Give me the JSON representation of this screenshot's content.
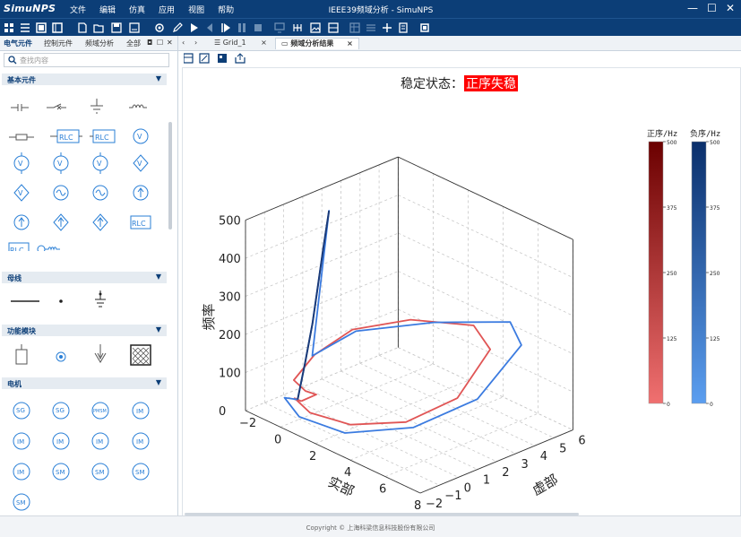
{
  "app": {
    "logo": "SimuNPS",
    "window_title": "IEEE39频域分析 - SimuNPS",
    "menu": [
      "文件",
      "编辑",
      "仿真",
      "应用",
      "视图",
      "帮助"
    ],
    "window_controls": [
      "—",
      "☐",
      "✕"
    ]
  },
  "sidebar": {
    "tabs": [
      "电气元件",
      "控制元件",
      "频域分析",
      "全部"
    ],
    "search_placeholder": "查找内容",
    "sections": [
      {
        "title": "基本元件",
        "items": [
          "ground-symbol",
          "switch-symbol",
          "ground-symbol",
          "inductor-symbol",
          "resistor-symbol",
          "rlc-series",
          "rlc-shunt",
          "voltage-source",
          "voltage-source",
          "voltage-source",
          "voltage-source",
          "controlled-voltage-source",
          "ac-source",
          "ac-source",
          "ac-source",
          "current-source",
          "current-source",
          "controlled-current-source",
          "controlled-current-source",
          "rlc-branch",
          "rlc-branch",
          "mutual-inductor"
        ]
      },
      {
        "title": "母线",
        "items": [
          "bus-line",
          "bus-node",
          "bus-ground"
        ]
      },
      {
        "title": "功能模块",
        "items": [
          "block-symbol",
          "measure-symbol",
          "fault-symbol",
          "hatched-block"
        ]
      },
      {
        "title": "电机",
        "items": [
          "SG",
          "SG",
          "PMSM",
          "IM",
          "IM",
          "IM",
          "IM",
          "IM",
          "IM",
          "SM",
          "SM",
          "SM",
          "SM"
        ]
      }
    ]
  },
  "doc_tabs": {
    "nav": [
      "‹",
      "›"
    ],
    "tabs": [
      {
        "label": "Grid_1",
        "close": "×"
      },
      {
        "label": "频域分析结果",
        "close": "×"
      }
    ]
  },
  "plot": {
    "status_label": "稳定状态：",
    "status_value": "正序失稳",
    "status_color": "#ff0000",
    "z_label": "频率",
    "x_label": "实部",
    "y_label": "虚部",
    "z_ticks": [
      "0",
      "100",
      "200",
      "300",
      "400",
      "500"
    ],
    "x_ticks": [
      "−2",
      "0",
      "2",
      "4",
      "6",
      "8"
    ],
    "y_ticks": [
      "−2",
      "−1",
      "0",
      "1",
      "2",
      "3",
      "4",
      "5",
      "6"
    ],
    "colorbars": [
      {
        "title": "正序/Hz",
        "ticks": [
          "500",
          "375",
          "250",
          "125",
          "0"
        ],
        "color_top": "#6b0000",
        "color_bottom": "#f07070"
      },
      {
        "title": "负序/Hz",
        "ticks": [
          "500",
          "375",
          "250",
          "125",
          "0"
        ],
        "color_top": "#0a2f6b",
        "color_bottom": "#5b9ef0"
      }
    ]
  },
  "chart_data": {
    "type": "line",
    "title": "",
    "xlabel": "实部",
    "ylabel": "虚部",
    "zlabel": "频率",
    "xlim": [
      -2,
      8
    ],
    "ylim": [
      -2,
      6
    ],
    "zlim": [
      0,
      500
    ],
    "series": [
      {
        "name": "正序/Hz",
        "color": "#e05555",
        "points": [
          [
            -1.0,
            0.0,
            5
          ],
          [
            -0.9,
            0.7,
            10
          ],
          [
            -1.3,
            0.5,
            15
          ],
          [
            -1.2,
            -0.2,
            60
          ],
          [
            -0.8,
            0.5,
            120
          ],
          [
            0.3,
            1.5,
            190
          ],
          [
            2.2,
            2.8,
            230
          ],
          [
            4.5,
            4.0,
            240
          ],
          [
            6.0,
            3.5,
            220
          ],
          [
            6.3,
            1.5,
            140
          ],
          [
            5.0,
            0.0,
            80
          ],
          [
            2.7,
            -0.8,
            40
          ],
          [
            0.6,
            -1.0,
            30
          ],
          [
            -0.5,
            -0.8,
            40
          ],
          [
            -1.0,
            0.0,
            5
          ]
        ]
      },
      {
        "name": "负序/Hz",
        "color": "#3b7be0",
        "points": [
          [
            -1.2,
            0.0,
            5
          ],
          [
            -1.0,
            0.2,
            100
          ],
          [
            -0.9,
            0.5,
            200
          ],
          [
            -0.7,
            0.6,
            300
          ],
          [
            -0.6,
            0.8,
            400
          ],
          [
            -0.5,
            1.0,
            495
          ],
          [
            -0.8,
            0.4,
            120
          ],
          [
            0.5,
            1.5,
            190
          ],
          [
            3.0,
            3.3,
            230
          ],
          [
            5.5,
            5.0,
            250
          ],
          [
            6.8,
            4.4,
            230
          ],
          [
            6.9,
            2.0,
            140
          ],
          [
            5.3,
            0.1,
            70
          ],
          [
            2.6,
            -1.0,
            20
          ],
          [
            0.2,
            -1.2,
            15
          ],
          [
            -1.3,
            -0.6,
            20
          ],
          [
            -1.2,
            0.0,
            5
          ]
        ]
      }
    ]
  },
  "footer": {
    "copyright": "Copyright © 上海科梁信息科技股份有限公司"
  }
}
